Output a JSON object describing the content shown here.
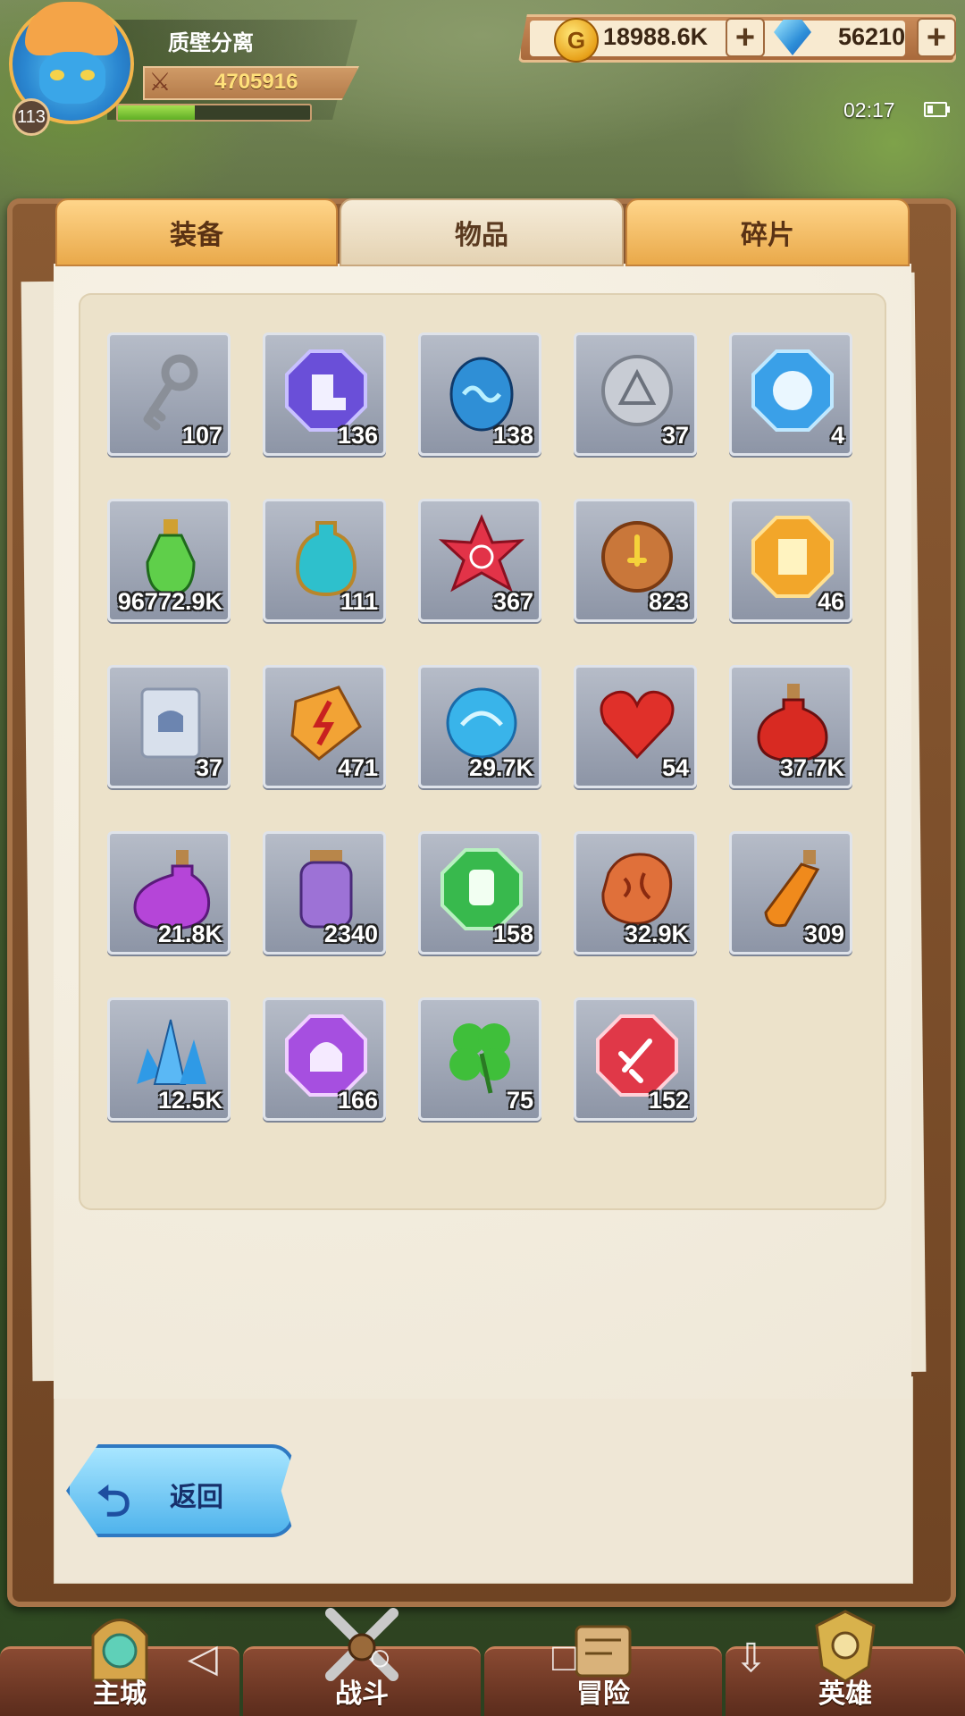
{
  "player": {
    "name": "质壁分离",
    "level": "113",
    "power": "4705916",
    "xp_fraction": 0.4
  },
  "currencies": {
    "coins": "18988.6K",
    "gems": "56210",
    "coin_symbol": "G"
  },
  "status": {
    "time": "02:17"
  },
  "tabs": [
    {
      "label": "装备",
      "active": false
    },
    {
      "label": "物品",
      "active": true
    },
    {
      "label": "碎片",
      "active": false
    }
  ],
  "items": [
    {
      "icon": "key-icon",
      "count": "107",
      "color": "#8a8f98"
    },
    {
      "icon": "boots-gem-icon",
      "count": "136",
      "color": "#6a4fd8"
    },
    {
      "icon": "blue-egg-icon",
      "count": "138",
      "color": "#2f8fd6"
    },
    {
      "icon": "silver-coin-icon",
      "count": "37",
      "color": "#c8ccd4"
    },
    {
      "icon": "helmet-gem-icon",
      "count": "4",
      "color": "#3aa0e8"
    },
    {
      "icon": "green-potion-icon",
      "count": "96772.9K",
      "color": "#5fcf4a"
    },
    {
      "icon": "teal-vase-icon",
      "count": "111",
      "color": "#2ec0cc"
    },
    {
      "icon": "red-star-icon",
      "count": "367",
      "color": "#e23348"
    },
    {
      "icon": "bronze-coin-icon",
      "count": "823",
      "color": "#c9773a"
    },
    {
      "icon": "armor-gem-icon",
      "count": "46",
      "color": "#f2a62a"
    },
    {
      "icon": "scroll-icon",
      "count": "37",
      "color": "#d8e0ec"
    },
    {
      "icon": "lightning-stone-icon",
      "count": "471",
      "color": "#f2a335"
    },
    {
      "icon": "water-orb-icon",
      "count": "29.7K",
      "color": "#39b4ea"
    },
    {
      "icon": "heart-icon",
      "count": "54",
      "color": "#e0302a"
    },
    {
      "icon": "red-potion-icon",
      "count": "37.7K",
      "color": "#d82a22"
    },
    {
      "icon": "purple-potion-icon",
      "count": "21.8K",
      "color": "#b545d8"
    },
    {
      "icon": "purple-jar-icon",
      "count": "2340",
      "color": "#9d72d6"
    },
    {
      "icon": "glove-gem-icon",
      "count": "158",
      "color": "#38b94d"
    },
    {
      "icon": "rune-stone-icon",
      "count": "32.9K",
      "color": "#e0703a"
    },
    {
      "icon": "orange-vial-icon",
      "count": "309",
      "color": "#f08a1c"
    },
    {
      "icon": "blue-crystal-icon",
      "count": "12.5K",
      "color": "#2f9ae6"
    },
    {
      "icon": "helm-purple-gem-icon",
      "count": "166",
      "color": "#a64fe0"
    },
    {
      "icon": "clover-icon",
      "count": "75",
      "color": "#3fbf3a"
    },
    {
      "icon": "sword-gem-icon",
      "count": "152",
      "color": "#e03848"
    }
  ],
  "back_button": {
    "label": "返回"
  },
  "bottom_nav": [
    {
      "label": "主城",
      "icon": "city-icon"
    },
    {
      "label": "战斗",
      "icon": "crossed-swords-icon"
    },
    {
      "label": "冒险",
      "icon": "map-icon"
    },
    {
      "label": "英雄",
      "icon": "hero-crest-icon"
    }
  ],
  "colors": {
    "tab_active": "#f6ecd8",
    "tab_inactive": "#ffd58a",
    "slot_bg": "#a6adbb",
    "back_button": "#4fb3ec"
  }
}
